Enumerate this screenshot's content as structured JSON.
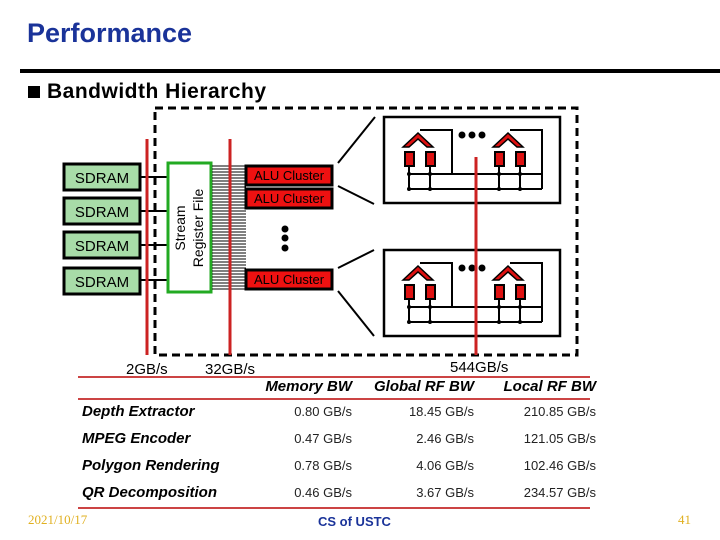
{
  "slide": {
    "title": "Performance",
    "bullet": "Bandwidth Hierarchy"
  },
  "diagram": {
    "sdram_labels": [
      "SDRAM",
      "SDRAM",
      "SDRAM",
      "SDRAM"
    ],
    "srf_label_line1": "Stream",
    "srf_label_line2": "Register File",
    "alu_labels": [
      "ALU Cluster",
      "ALU Cluster",
      "ALU Cluster"
    ],
    "bandwidths": {
      "memory": "2GB/s",
      "global_rf": "32GB/s",
      "local_rf": "544GB/s"
    },
    "colors": {
      "sdram_fill": "#a8dca8",
      "alu_fill": "#ee1111",
      "srf_border": "#22aa22",
      "bw_line": "#cc2222"
    }
  },
  "table": {
    "headers": [
      "",
      "Memory BW",
      "Global RF BW",
      "Local RF BW"
    ],
    "rows": [
      {
        "name": "Depth Extractor",
        "memory": "0.80 GB/s",
        "global": "18.45 GB/s",
        "local": "210.85 GB/s"
      },
      {
        "name": "MPEG Encoder",
        "memory": "0.47 GB/s",
        "global": "2.46 GB/s",
        "local": "121.05 GB/s"
      },
      {
        "name": "Polygon Rendering",
        "memory": "0.78 GB/s",
        "global": "4.06 GB/s",
        "local": "102.46 GB/s"
      },
      {
        "name": "QR Decomposition",
        "memory": "0.46 GB/s",
        "global": "3.67 GB/s",
        "local": "234.57 GB/s"
      }
    ]
  },
  "footer": {
    "date": "2021/10/17",
    "center": "CS of USTC",
    "page": "41"
  }
}
